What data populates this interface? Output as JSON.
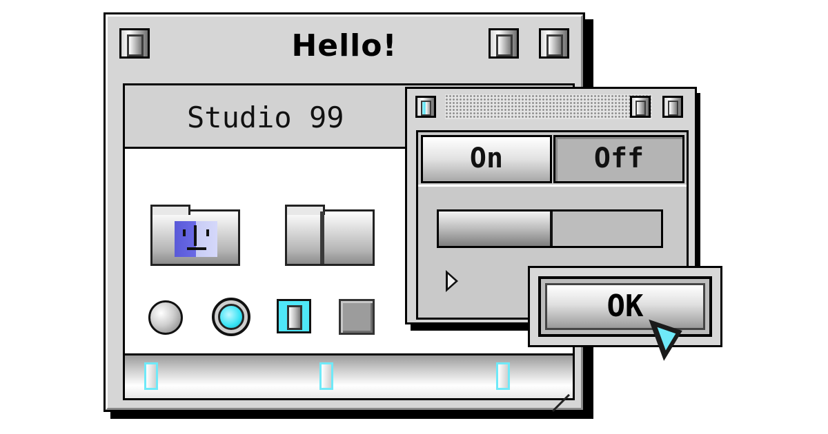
{
  "main_window": {
    "title": "Hello!",
    "header_text": "Studio 99",
    "title_buttons": [
      "close-box",
      "zoom-box",
      "collapse-box"
    ],
    "controls": {
      "radio_1": "unselected",
      "radio_2": "selected",
      "checkbox_1": "checked",
      "checkbox_2": "unchecked"
    },
    "scrollbar": {
      "thumbs": 3
    }
  },
  "palette_window": {
    "segments": [
      {
        "label": "On",
        "state": "raised"
      },
      {
        "label": "Off",
        "state": "pressed"
      }
    ],
    "progress": 0.5
  },
  "dialog": {
    "ok_label": "OK"
  },
  "colors": {
    "accent": "#4fe7f8",
    "finder_blue": "#5a5ad8",
    "chrome": "#d6d6d6"
  },
  "icons": {
    "finder": "finder-face-icon",
    "folder": "folder-icon",
    "cursor": "arrow-cursor-icon"
  }
}
